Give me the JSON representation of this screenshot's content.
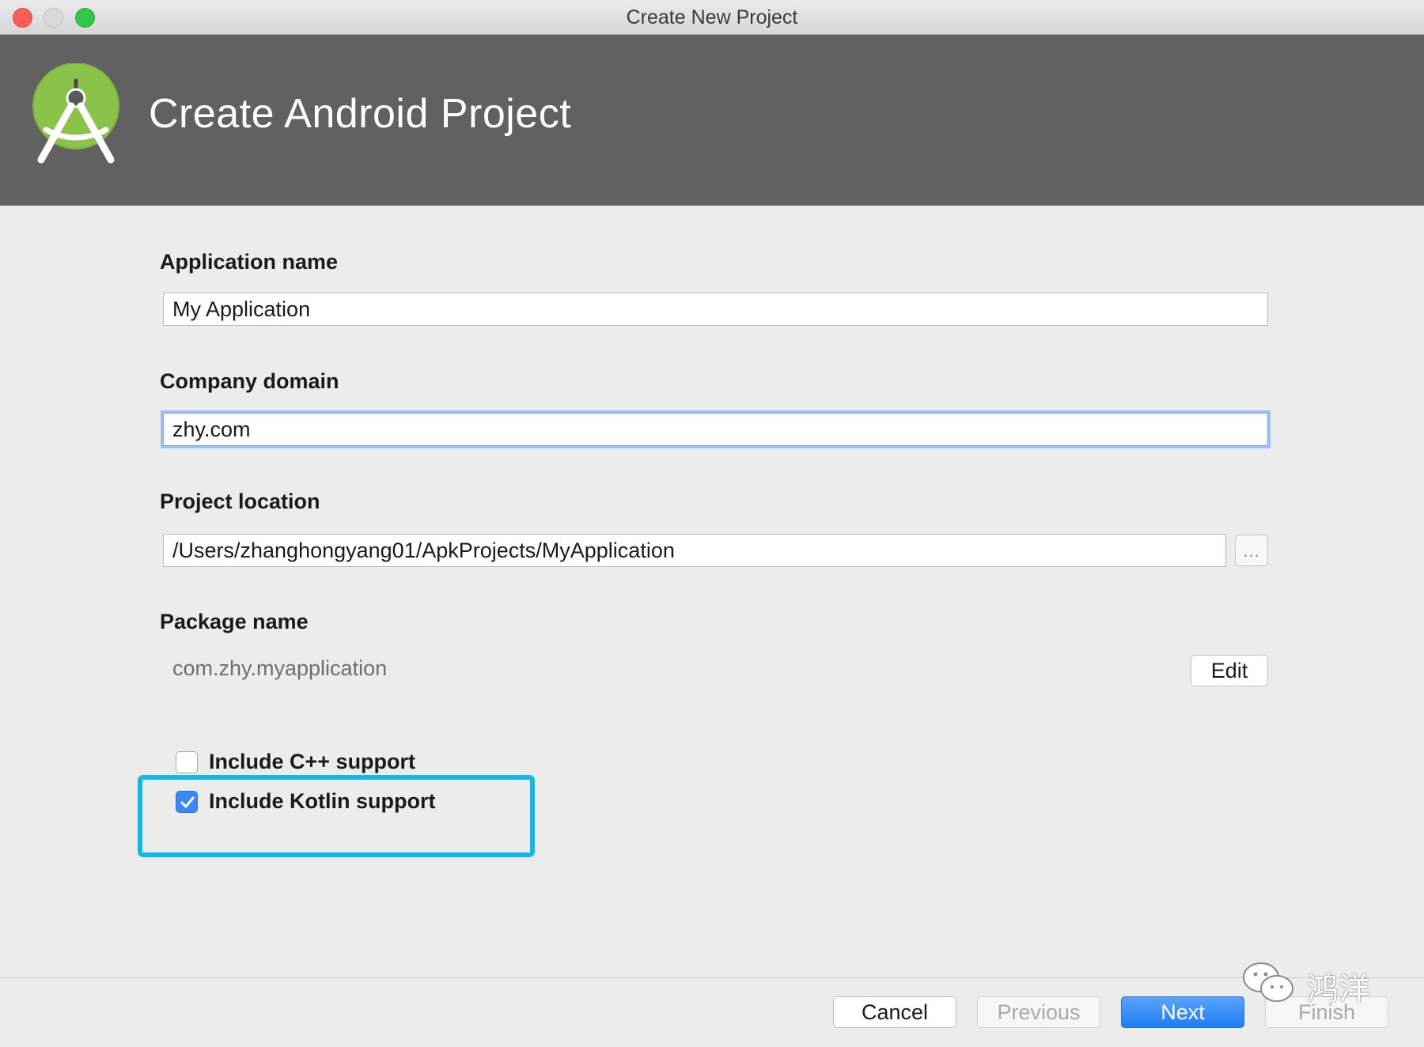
{
  "window": {
    "title": "Create New Project"
  },
  "header": {
    "title": "Create Android Project",
    "logo_icon": "android-studio-logo-icon"
  },
  "form": {
    "application_name": {
      "label": "Application name",
      "value": "My Application"
    },
    "company_domain": {
      "label": "Company domain",
      "value": "zhy.com",
      "focused": true
    },
    "project_location": {
      "label": "Project location",
      "value": "/Users/zhanghongyang01/ApkProjects/MyApplication",
      "browse_label": "..."
    },
    "package_name": {
      "label": "Package name",
      "value": "com.zhy.myapplication",
      "edit_label": "Edit"
    }
  },
  "options": [
    {
      "label": "Include C++ support",
      "checked": false
    },
    {
      "label": "Include Kotlin support",
      "checked": true
    }
  ],
  "footer": {
    "cancel_label": "Cancel",
    "previous_label": "Previous",
    "next_label": "Next",
    "finish_label": "Finish"
  },
  "watermark": {
    "text": "鸿洋"
  },
  "colors": {
    "header_bg": "#616161",
    "accent": "#1f7ef3",
    "highlight": "#12b8ea",
    "android_green": "#8bc34a"
  }
}
